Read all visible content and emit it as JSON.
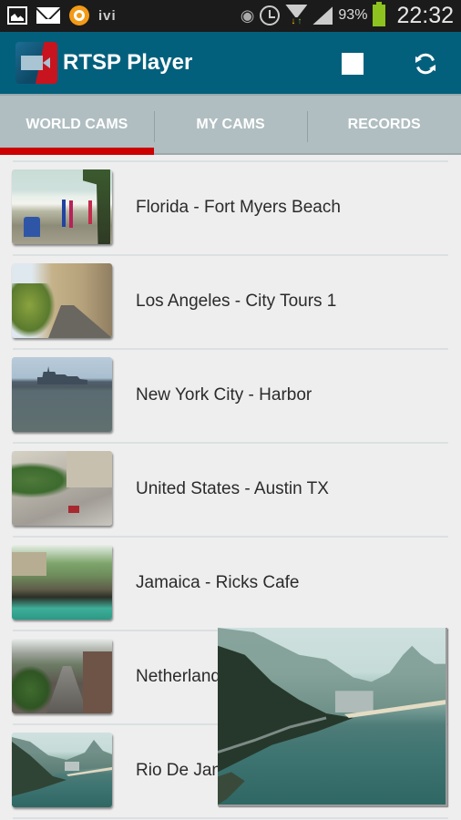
{
  "status_bar": {
    "left_icons": [
      "gallery-icon",
      "mail-icon",
      "orange-app-icon"
    ],
    "ivi_label": "ivi",
    "right_icons": [
      "eye-icon",
      "alarm-icon",
      "wifi-icon",
      "signal-icon",
      "battery-icon"
    ],
    "battery_percent": "93%",
    "time": "22:32",
    "battery_color": "#8dc21f"
  },
  "action_bar": {
    "app_title": "RTSP Player",
    "logo_icon": "video-camera-icon",
    "actions": [
      {
        "name": "stop",
        "icon": "stop-icon"
      },
      {
        "name": "refresh",
        "icon": "refresh-icon"
      }
    ],
    "background_color": "#03607d"
  },
  "tabs": {
    "items": [
      {
        "label": "WORLD CAMS",
        "active": true
      },
      {
        "label": "MY CAMS",
        "active": false
      },
      {
        "label": "RECORDS",
        "active": false
      }
    ],
    "indicator_color": "#cc0000",
    "background_color": "#b0bec1"
  },
  "cams": [
    {
      "label": "Florida - Fort Myers Beach",
      "thumbnail": "beach-scene"
    },
    {
      "label": "Los Angeles - City Tours 1",
      "thumbnail": "city-street-scene"
    },
    {
      "label": "New York City - Harbor",
      "thumbnail": "harbor-skyline-scene"
    },
    {
      "label": "United States - Austin TX",
      "thumbnail": "intersection-scene"
    },
    {
      "label": "Jamaica - Ricks Cafe",
      "thumbnail": "cliff-lagoon-scene"
    },
    {
      "label": "Netherland",
      "thumbnail": "canal-scene"
    },
    {
      "label": "Rio De Jan",
      "thumbnail": "coastline-scene"
    }
  ],
  "preview": {
    "description": "Floating live preview of Rio De Janeiro coastline cam"
  }
}
